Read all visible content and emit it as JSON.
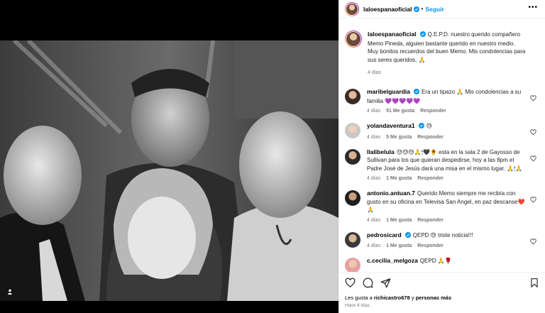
{
  "post": {
    "author": "laloespanaoficial",
    "follow_label": "Seguir",
    "more_label": "•••",
    "caption": "Q.E.P.D. nuestro querido compañero Memo Pineda, alguien bastante querido en nuestro medio. Muy bonitos recuerdos del buen Memo. Mis condolencias para sus seres queridos. 🙏",
    "caption_age": "4 días",
    "likes_prefix": "Les gusta a",
    "likes_user": "richicastro678",
    "likes_suffix": "y",
    "likes_others": "personas más",
    "posted_ago": "Hace 4 días"
  },
  "comments": [
    {
      "user": "maribelguardia",
      "verified": true,
      "text": "Era un tipazo 🙏 Mis condolencias a su familia 💜💜💜💜💜",
      "age": "4 días",
      "likes": "51 Me gusta",
      "reply": "Responder"
    },
    {
      "user": "yolandaventura1",
      "verified": true,
      "text": "😓",
      "age": "4 días",
      "likes": "5 Me gusta",
      "reply": "Responder"
    },
    {
      "user": "llalibelula",
      "verified": false,
      "text": "😓😓😓🙏🕯🖤🌻 esta en la sala 2 de Gayosso de Sullivan para los que quieran despedirse, hoy a las 8pm el Padre José de Jesús dará una misa en el mismo lugar. 🙏🕯🙏",
      "age": "4 días",
      "likes": "1 Me gusta",
      "reply": "Responder"
    },
    {
      "user": "antonio.antuan.7",
      "verified": false,
      "text": "Querido Memo siempre me recibía con gusto en su oficina en Televisa San Angel, en paz descanse❤️🙏",
      "age": "4 días",
      "likes": "1 Me gusta",
      "reply": "Responder"
    },
    {
      "user": "pedrosicard",
      "verified": true,
      "text": "QEPD 😓 triste noticia!!!",
      "age": "4 días",
      "likes": "1 Me gusta",
      "reply": "Responder"
    },
    {
      "user": "c.cecilia_melgoza",
      "verified": false,
      "text": "QEPD 🙏🌹",
      "age": "",
      "likes": "",
      "reply": ""
    }
  ],
  "colors": {
    "accent": "#0095f6",
    "verified": "#0095f6",
    "meta_text": "#737373",
    "photo_background": "#000000"
  },
  "icons": [
    "tag-user-icon",
    "verified-badge-icon",
    "heart-icon",
    "comment-icon",
    "share-icon",
    "bookmark-icon",
    "more-options-icon"
  ]
}
